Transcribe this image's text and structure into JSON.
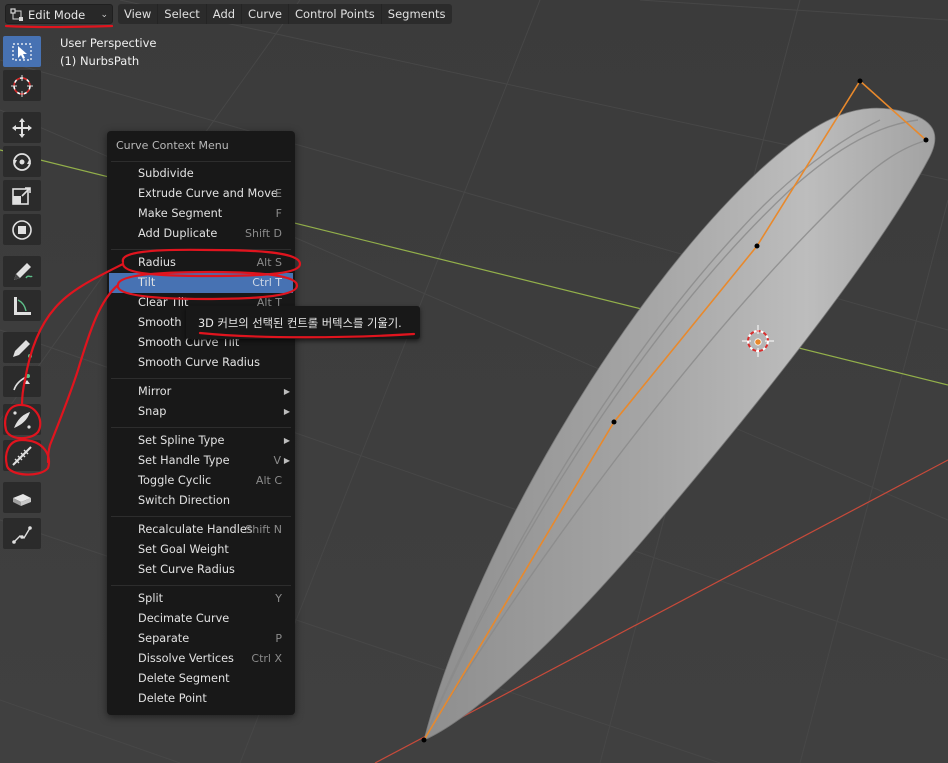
{
  "header": {
    "mode": "Edit Mode",
    "menus": [
      "View",
      "Select",
      "Add",
      "Curve",
      "Control Points",
      "Segments"
    ]
  },
  "overlay": {
    "perspective": "User Perspective",
    "object": "(1) NurbsPath"
  },
  "toolbar": {
    "tools": [
      "select-box-icon",
      "cursor-icon",
      "move-icon",
      "rotate-icon",
      "scale-icon",
      "transform-icon",
      "annotate-icon",
      "measure-icon",
      "draw-icon",
      "extrude-icon",
      "radius-icon",
      "tilt-icon",
      "randomize-icon",
      "curve-pen-icon"
    ]
  },
  "context_menu": {
    "title": "Curve Context Menu",
    "groups": [
      [
        {
          "label": "Subdivide",
          "shortcut": ""
        },
        {
          "label": "Extrude Curve and Move",
          "shortcut": "E"
        },
        {
          "label": "Make Segment",
          "shortcut": "F"
        },
        {
          "label": "Add Duplicate",
          "shortcut": "Shift D"
        }
      ],
      [
        {
          "label": "Radius",
          "shortcut": "Alt S"
        },
        {
          "label": "Tilt",
          "shortcut": "Ctrl T"
        },
        {
          "label": "Clear Tilt",
          "shortcut": "Alt T"
        },
        {
          "label": "Smooth",
          "shortcut": ""
        },
        {
          "label": "Smooth Curve Tilt",
          "shortcut": ""
        },
        {
          "label": "Smooth Curve Radius",
          "shortcut": ""
        }
      ],
      [
        {
          "label": "Mirror",
          "shortcut": ""
        },
        {
          "label": "Snap",
          "shortcut": ""
        }
      ],
      [
        {
          "label": "Set Spline Type",
          "shortcut": ""
        },
        {
          "label": "Set Handle Type",
          "shortcut": "V"
        },
        {
          "label": "Toggle Cyclic",
          "shortcut": "Alt C"
        },
        {
          "label": "Switch Direction",
          "shortcut": ""
        }
      ],
      [
        {
          "label": "Recalculate Handles",
          "shortcut": "Shift N"
        },
        {
          "label": "Set Goal Weight",
          "shortcut": ""
        },
        {
          "label": "Set Curve Radius",
          "shortcut": ""
        }
      ],
      [
        {
          "label": "Split",
          "shortcut": "Y"
        },
        {
          "label": "Decimate Curve",
          "shortcut": ""
        },
        {
          "label": "Separate",
          "shortcut": "P"
        },
        {
          "label": "Dissolve Vertices",
          "shortcut": "Ctrl X"
        },
        {
          "label": "Delete Segment",
          "shortcut": ""
        },
        {
          "label": "Delete Point",
          "shortcut": ""
        }
      ]
    ],
    "highlighted": "Tilt",
    "submenu_items": [
      "Mirror",
      "Snap",
      "Set Spline Type",
      "Set Handle Type"
    ]
  },
  "tooltip": {
    "text": "3D 커브의 선택된 컨트롤 버텍스를 기울기."
  },
  "colors": {
    "accent": "#4772b3",
    "curve": "#e8892c",
    "annotation": "#e0141e",
    "x_axis": "#93b04a",
    "y_axis": "#c84a3a"
  }
}
